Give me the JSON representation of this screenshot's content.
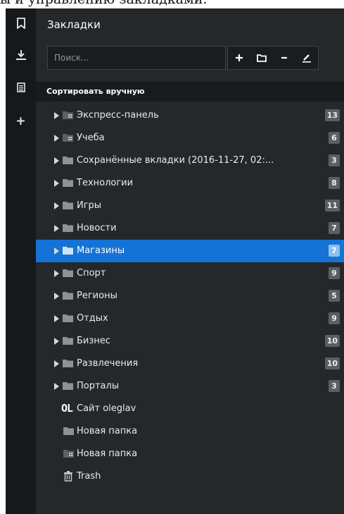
{
  "top_text": "ы и управлению закладками.",
  "sidebar": {
    "items": [
      {
        "icon": "bookmark-icon"
      },
      {
        "icon": "download-icon"
      },
      {
        "icon": "notes-icon"
      },
      {
        "icon": "plus-icon",
        "glyph": "+"
      }
    ]
  },
  "panel": {
    "title": "Закладки",
    "search": {
      "placeholder": "Поиск...",
      "value": ""
    },
    "toolbar": {
      "add": "add-icon",
      "folder": "folder-icon",
      "remove": "remove-icon",
      "edit": "edit-icon"
    },
    "sort_label": "Сортировать вручную"
  },
  "tree": {
    "items": [
      {
        "label": "Экспресс-панель",
        "count": "13",
        "icon": "speed-dial-folder-icon",
        "expandable": true
      },
      {
        "label": "Учеба",
        "count": "6",
        "icon": "speed-dial-folder-icon",
        "expandable": true
      },
      {
        "label": "Сохранённые вкладки (2016-11-27, 02:...",
        "count": "3",
        "icon": "folder-icon",
        "expandable": true
      },
      {
        "label": "Технологии",
        "count": "8",
        "icon": "folder-icon",
        "expandable": true
      },
      {
        "label": "Игры",
        "count": "11",
        "icon": "folder-icon",
        "expandable": true
      },
      {
        "label": "Новости",
        "count": "7",
        "icon": "folder-icon",
        "expandable": true
      },
      {
        "label": "Магазины",
        "count": "7",
        "icon": "folder-icon",
        "expandable": true,
        "selected": true
      },
      {
        "label": "Спорт",
        "count": "9",
        "icon": "folder-icon",
        "expandable": true
      },
      {
        "label": "Регионы",
        "count": "5",
        "icon": "folder-icon",
        "expandable": true
      },
      {
        "label": "Отдых",
        "count": "9",
        "icon": "folder-icon",
        "expandable": true
      },
      {
        "label": "Бизнес",
        "count": "10",
        "icon": "folder-icon",
        "expandable": true
      },
      {
        "label": "Развлечения",
        "count": "10",
        "icon": "folder-icon",
        "expandable": true
      },
      {
        "label": "Порталы",
        "count": "3",
        "icon": "folder-icon",
        "expandable": true
      },
      {
        "label": "Сайт oleglav",
        "icon": "ol-logo-icon",
        "logo_text": "OL"
      },
      {
        "label": "Новая папка",
        "icon": "folder-icon"
      },
      {
        "label": "Новая папка",
        "icon": "speed-dial-folder-icon"
      },
      {
        "label": "Trash",
        "icon": "trash-icon"
      }
    ]
  },
  "colors": {
    "accent": "#1673d6",
    "background": "#24282b",
    "rail": "#16191b"
  }
}
